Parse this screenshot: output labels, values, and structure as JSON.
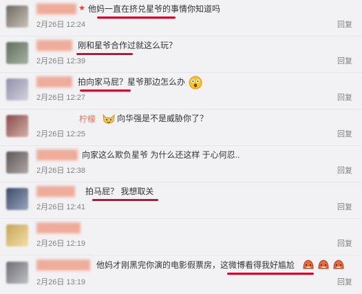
{
  "comments": [
    {
      "name": "",
      "text": "他妈一直在挤兑星爷的事情你知道吗",
      "time": "2月26日 12:24",
      "reply": "回复",
      "avatar_colors": [
        "#6d6a63",
        "#c9c3b7"
      ]
    },
    {
      "name": "",
      "text": "刚和星爷合作过就这么玩？",
      "time": "2月26日 12:39",
      "reply": "回复",
      "avatar_colors": [
        "#5f6d5e",
        "#a8b2a0"
      ]
    },
    {
      "name": "",
      "text": "拍向家马屁？星爷那边怎么办",
      "time": "2月26日 12:27",
      "reply": "回复",
      "avatar_colors": [
        "#8e8fa8",
        "#d5d2e0"
      ]
    },
    {
      "name": "柠檬",
      "text": "向华强是不是威胁你了？",
      "time": "2月26日 12:25",
      "reply": "回复",
      "avatar_colors": [
        "#8a4a4a",
        "#d2b0a8"
      ]
    },
    {
      "name": "",
      "text": "向家这么欺负星爷 为什么还这样 于心何忍..",
      "time": "2月26日 12:38",
      "reply": "回复",
      "avatar_colors": [
        "#5c5656",
        "#b0a8a6"
      ]
    },
    {
      "name": "",
      "text": "拍马屁？ 我想取关",
      "time": "2月26日 12:41",
      "reply": "回复",
      "avatar_colors": [
        "#3d4a66",
        "#9aa6c0"
      ]
    },
    {
      "name": "",
      "text": "",
      "time": "2月26日 12:19",
      "reply": "回复",
      "avatar_colors": [
        "#c8a457",
        "#f1e0a8"
      ]
    },
    {
      "name": "",
      "text": "他妈才刚黑完你演的电影假票房，这微博看得我好尴尬",
      "time": "2月26日 13:19",
      "reply": "回复",
      "avatar_colors": [
        "#6e6e74",
        "#bfbfc6"
      ]
    }
  ],
  "colors": {
    "underline": "#c8102e",
    "username": "#eb7350",
    "star": "#e8402e"
  }
}
